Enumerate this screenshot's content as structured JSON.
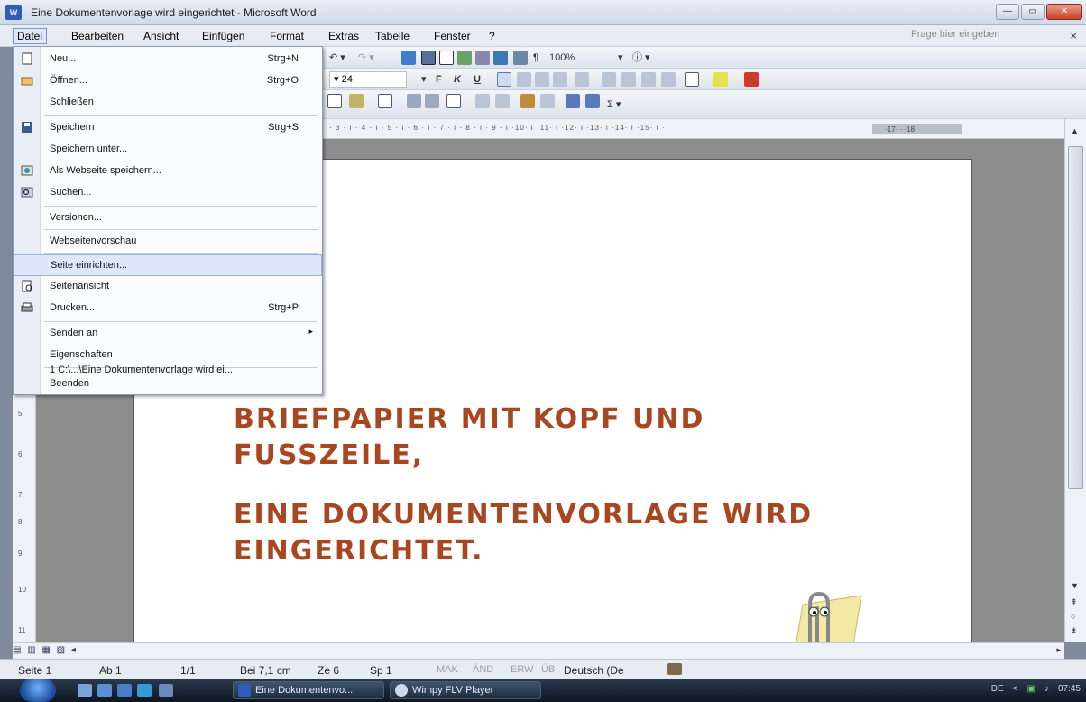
{
  "window": {
    "title": "Eine Dokumentenvorlage wird eingerichtet - Microsoft Word",
    "app_icon": "W"
  },
  "menubar": {
    "items": [
      "Datei",
      "Bearbeiten",
      "Ansicht",
      "Einfügen",
      "Format",
      "Extras",
      "Tabelle",
      "Fenster",
      "?"
    ],
    "ask_placeholder": "Frage hier eingeben",
    "close_glyph": "×"
  },
  "toolbar": {
    "zoom": "100%",
    "font_size": "24",
    "bold": "F",
    "italic": "K",
    "underline": "U"
  },
  "file_menu": {
    "items": [
      {
        "label": "Neu...",
        "shortcut": "Strg+N",
        "icon": "new-document-icon"
      },
      {
        "label": "Öffnen...",
        "shortcut": "Strg+O",
        "icon": "open-folder-icon"
      },
      {
        "label": "Schließen",
        "shortcut": "",
        "icon": ""
      },
      {
        "label": "Speichern",
        "shortcut": "Strg+S",
        "icon": "save-disk-icon"
      },
      {
        "label": "Speichern unter...",
        "shortcut": "",
        "icon": ""
      },
      {
        "label": "Als Webseite speichern...",
        "shortcut": "",
        "icon": "web-page-icon"
      },
      {
        "label": "Suchen...",
        "shortcut": "",
        "icon": "search-icon"
      },
      {
        "label": "Versionen...",
        "shortcut": "",
        "icon": ""
      },
      {
        "label": "Webseitenvorschau",
        "shortcut": "",
        "icon": ""
      },
      {
        "label": "Seite einrichten...",
        "shortcut": "",
        "icon": ""
      },
      {
        "label": "Seitenansicht",
        "shortcut": "",
        "icon": "print-preview-icon"
      },
      {
        "label": "Drucken...",
        "shortcut": "Strg+P",
        "icon": "printer-icon"
      },
      {
        "label": "Senden an",
        "shortcut": "",
        "icon": "",
        "submenu": "▸"
      },
      {
        "label": "Eigenschaften",
        "shortcut": "",
        "icon": ""
      },
      {
        "label": "1 C:\\...\\Eine Dokumentenvorlage wird ei...",
        "shortcut": "",
        "icon": ""
      },
      {
        "label": "Beenden",
        "shortcut": "",
        "icon": ""
      }
    ],
    "highlighted": "Seite einrichten..."
  },
  "document": {
    "line1": "BRIEFPAPIER MIT KOPF UND",
    "line2": "FUSSZEILE,",
    "line3": "EINE DOKUMENTENVORLAGE WIRD",
    "line4": "EINGERICHTET."
  },
  "ruler": {
    "ticks": "· 3 · ı · 4 · ı · 5 · ı · 6 · ı · 7 · ı · 8 · ı · 9 · ı ·10· ı ·11· ı ·12· ı ·13· ı ·14· ı ·15· ı ·",
    "selected": "·17· · ·18·"
  },
  "vruler": {
    "ticks": [
      "5",
      "6",
      "7",
      "8",
      "9",
      "10",
      "11"
    ]
  },
  "statusbar": {
    "page": "Seite 1",
    "section": "Ab 1",
    "pages": "1/1",
    "position": "Bei 7,1 cm",
    "line": "Ze 6",
    "column": "Sp 1",
    "mak": "MAK",
    "and": "ÄND",
    "erw": "ERW",
    "ub": "ÜB",
    "language": "Deutsch (De"
  },
  "taskbar": {
    "tasks": [
      {
        "label": "Eine Dokumentenvo..."
      },
      {
        "label": "Wimpy FLV Player"
      }
    ],
    "lang": "DE",
    "arrow": "<",
    "clock": "07:45"
  },
  "colors": {
    "headline": "#a8471f",
    "menu_highlight": "#dfe8f8"
  }
}
